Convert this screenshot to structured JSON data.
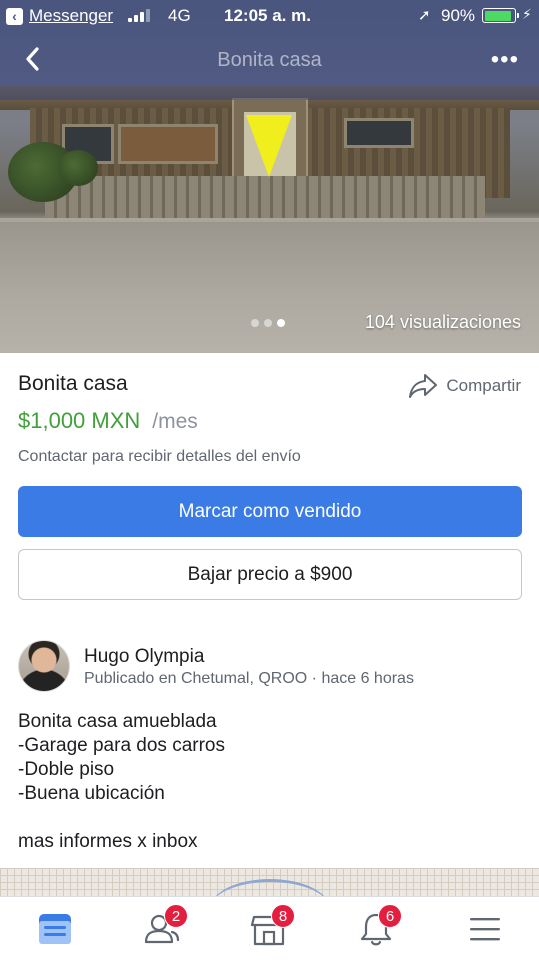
{
  "status_bar": {
    "back_app": "Messenger",
    "network": "4G",
    "time": "12:05 a. m.",
    "battery": "90%",
    "battery_level": 0.9
  },
  "nav": {
    "title": "Bonita casa",
    "more_glyph": "•••"
  },
  "photo": {
    "views": "104 visualizaciones",
    "page_count": 3,
    "active_page": 3
  },
  "listing": {
    "title": "Bonita casa",
    "share_label": "Compartir",
    "price": "$1,000 MXN",
    "period": "/mes",
    "shipping_note": "Contactar para recibir detalles del envío",
    "mark_sold_label": "Marcar como vendido",
    "lower_price_label": "Bajar precio a $900"
  },
  "seller": {
    "name": "Hugo Olympia",
    "meta": "Publicado en Chetumal, QROO · hace 6 horas"
  },
  "description": "Bonita casa amueblada\n-Garage para dos carros\n-Doble piso\n-Buena ubicación\n\nmas informes x inbox",
  "tabbar": {
    "items": [
      {
        "name": "feed",
        "badge": ""
      },
      {
        "name": "friend-requests",
        "badge": "2"
      },
      {
        "name": "marketplace",
        "badge": "8"
      },
      {
        "name": "notifications",
        "badge": "6"
      },
      {
        "name": "menu",
        "badge": ""
      }
    ]
  },
  "colors": {
    "accent_blue": "#3b7be6",
    "price_green": "#42a03c",
    "badge_red": "#e41e3f",
    "tab_active": "#3b7be6",
    "tab_inactive": "#606770"
  }
}
